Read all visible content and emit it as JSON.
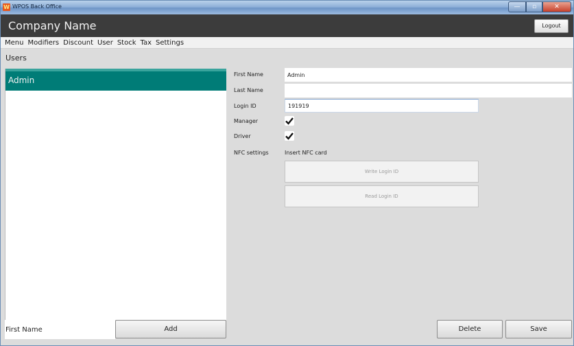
{
  "window": {
    "title": "WPOS Back Office",
    "app_icon_glyph": "W",
    "controls": {
      "minimize": "—",
      "maximize": "▫",
      "close": "✕"
    }
  },
  "header": {
    "company_name": "Company Name",
    "logout_label": "Logout"
  },
  "menu": {
    "items": [
      {
        "label": "Menu"
      },
      {
        "label": "Modifiers"
      },
      {
        "label": "Discount"
      },
      {
        "label": "User"
      },
      {
        "label": "Stock"
      },
      {
        "label": "Tax"
      },
      {
        "label": "Settings"
      }
    ]
  },
  "users_panel": {
    "title": "Users",
    "users": [
      {
        "name": "Admin",
        "selected": true
      }
    ],
    "new_user_input": {
      "value": "",
      "placeholder": "First Name"
    },
    "add_label": "Add"
  },
  "form": {
    "first_name": {
      "label": "First Name",
      "value": "Admin"
    },
    "last_name": {
      "label": "Last Name",
      "value": ""
    },
    "login_id": {
      "label": "Login ID",
      "value": "191919"
    },
    "manager": {
      "label": "Manager",
      "checked": true
    },
    "driver": {
      "label": "Driver",
      "checked": true
    },
    "nfc": {
      "label": "NFC settings",
      "status": "Insert NFC card",
      "write_label": "Write Login ID",
      "read_label": "Read Login ID"
    }
  },
  "actions": {
    "delete_label": "Delete",
    "save_label": "Save"
  },
  "colors": {
    "accent": "#007c77",
    "header_bg": "#3c3c3c"
  }
}
